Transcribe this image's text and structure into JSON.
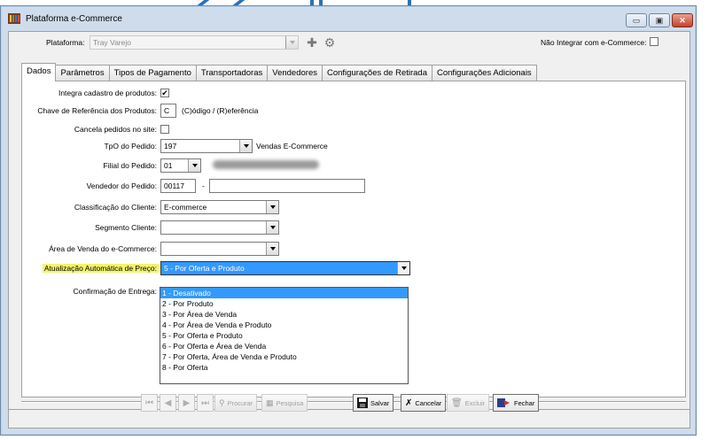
{
  "window": {
    "title": "Plataforma e-Commerce",
    "minimize_glyph": "▭",
    "maximize_glyph": "▣",
    "close_glyph": "✕"
  },
  "top": {
    "plataforma_label": "Plataforma:",
    "plataforma_value": "Tray Varejo",
    "nao_integrar_label": "Não Integrar com e-Commerce:",
    "nao_integrar_checked": false,
    "add_icon": "plus-icon",
    "settings_icon": "gear-icon"
  },
  "tabs": [
    {
      "label": "Dados",
      "active": true
    },
    {
      "label": "Parâmetros",
      "active": false
    },
    {
      "label": "Tipos de Pagamento",
      "active": false
    },
    {
      "label": "Transportadoras",
      "active": false
    },
    {
      "label": "Vendedores",
      "active": false
    },
    {
      "label": "Configurações de Retirada",
      "active": false
    },
    {
      "label": "Configurações Adicionais",
      "active": false
    }
  ],
  "form": {
    "integra_cadastro_label": "Integra cadastro de produtos:",
    "integra_cadastro_checked": true,
    "check_glyph": "✔",
    "chave_referencia_label": "Chave de Referência dos Produtos:",
    "chave_referencia_value": "C",
    "chave_referencia_hint": "(C)ódigo / (R)eferência",
    "cancela_pedidos_label": "Cancela pedidos no site:",
    "cancela_pedidos_checked": false,
    "tpo_label": "TpO do Pedido:",
    "tpo_value": "197",
    "tpo_desc": "Vendas E-Commerce",
    "filial_label": "Filial do Pedido:",
    "filial_value": "01",
    "vendedor_label": "Vendedor do Pedido:",
    "vendedor_code": "00117",
    "vendedor_sep": "-",
    "vendedor_name": "",
    "classificacao_label": "Classificação do Cliente:",
    "classificacao_value": "E-commerce",
    "segmento_label": "Segmento Cliente:",
    "segmento_value": "",
    "area_venda_label": "Área de Venda do e-Commerce:",
    "area_venda_value": "",
    "atualizacao_label": "Atualização Automática de Preço:",
    "atualizacao_value": "5 - Por Oferta e Produto",
    "confirmacao_label": "Confirmação de Entrega:"
  },
  "atualizacao_options": [
    "1 - Desativado",
    "2 - Por Produto",
    "3 - Por Área de Venda",
    "4 - Por Área de Venda e Produto",
    "5 - Por Oferta e Produto",
    "6 - Por Oferta e Área de Venda",
    "7 - Por Oferta, Área de Venda e Produto",
    "8 - Por Oferta"
  ],
  "toolbar": {
    "first_glyph": "⏮",
    "prev_glyph": "◀",
    "next_glyph": "▶",
    "last_glyph": "⏭",
    "procurar": "Procurar",
    "pesquisa": "Pesquisa",
    "salvar": "Salvar",
    "cancelar": "Cancelar",
    "excluir": "Excluir",
    "fechar": "Fechar"
  }
}
